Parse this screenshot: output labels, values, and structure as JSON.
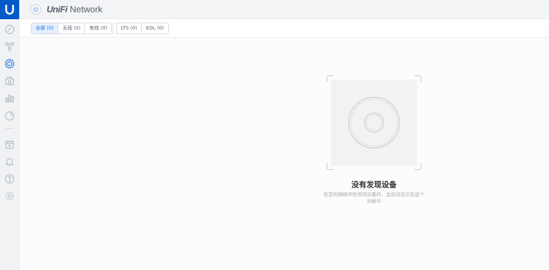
{
  "app": {
    "brand": "UniFi",
    "name": "Network"
  },
  "sidebar": {
    "items": [
      {
        "icon": "dashboard-icon"
      },
      {
        "icon": "topology-icon"
      },
      {
        "icon": "devices-icon",
        "active": true
      },
      {
        "icon": "clients-icon"
      },
      {
        "icon": "statistics-icon"
      },
      {
        "icon": "insights-icon"
      },
      {
        "icon": "events-icon"
      },
      {
        "icon": "alerts-icon"
      },
      {
        "icon": "help-icon"
      },
      {
        "icon": "settings-icon"
      }
    ]
  },
  "filters": {
    "group1": [
      {
        "label": "全部 (0)",
        "selected": true
      },
      {
        "label": "无线 (0)"
      },
      {
        "label": "有线 (0)"
      }
    ],
    "group2": [
      {
        "label": "LTS (0)"
      },
      {
        "label": "EOL (0)"
      }
    ]
  },
  "empty_state": {
    "title": "没有发现设备",
    "description": "在您的网络中检测到设备时，会自动显示在这个列表中"
  },
  "colors": {
    "accent": "#1f6fe0",
    "logo_bg": "#0559c9"
  }
}
